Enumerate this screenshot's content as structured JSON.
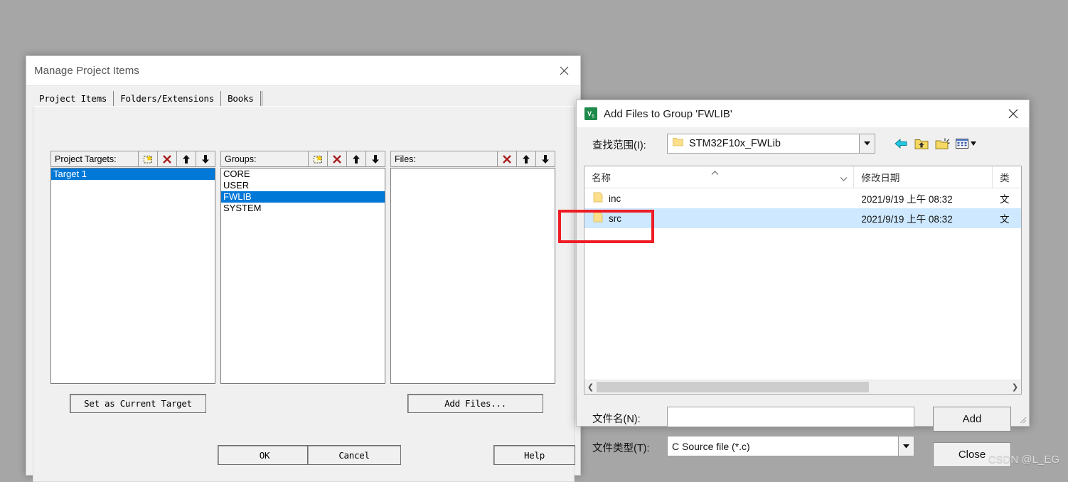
{
  "manage_dialog": {
    "title": "Manage Project Items",
    "close_icon": "close-icon",
    "tabs": [
      {
        "label": "Project Items",
        "active": true
      },
      {
        "label": "Folders/Extensions",
        "active": false
      },
      {
        "label": "Books",
        "active": false
      }
    ],
    "project_targets": {
      "header": "Project Targets:",
      "buttons": [
        "new-item-icon",
        "delete-icon",
        "move-up-icon",
        "move-down-icon"
      ],
      "items": [
        {
          "label": "Target 1",
          "selected": true
        }
      ]
    },
    "groups": {
      "header": "Groups:",
      "buttons": [
        "new-item-icon",
        "delete-icon",
        "move-up-icon",
        "move-down-icon"
      ],
      "items": [
        {
          "label": "CORE",
          "selected": false
        },
        {
          "label": "USER",
          "selected": false
        },
        {
          "label": "FWLIB",
          "selected": true
        },
        {
          "label": "SYSTEM",
          "selected": false
        }
      ]
    },
    "files": {
      "header": "Files:",
      "buttons": [
        "delete-icon",
        "move-up-icon",
        "move-down-icon"
      ],
      "items": []
    },
    "set_current_target_label": "Set as Current Target",
    "add_files_label": "Add Files...",
    "ok_label": "OK",
    "cancel_label": "Cancel",
    "help_label": "Help"
  },
  "add_files_dialog": {
    "title": "Add Files to Group 'FWLIB'",
    "app_icon": "keil-uvision-icon",
    "close_icon": "close-icon",
    "look_in_label": "查找范围(I):",
    "look_in_value": "STM32F10x_FWLib",
    "nav_icons": [
      "back-arrow-icon",
      "up-folder-icon",
      "new-folder-icon",
      "view-mode-icon"
    ],
    "columns": [
      {
        "label": "名称",
        "sorted": true,
        "sort_icon": "sort-ascending-icon"
      },
      {
        "label": "修改日期"
      },
      {
        "label": "类"
      }
    ],
    "rows": [
      {
        "name": "inc",
        "icon": "folder-icon",
        "modified": "2021/9/19 上午 08:32",
        "type": "文",
        "selected": false
      },
      {
        "name": "src",
        "icon": "folder-icon",
        "modified": "2021/9/19 上午 08:32",
        "type": "文",
        "selected": true
      }
    ],
    "scrollbar": {
      "left_icon": "chevron-left-icon",
      "right_icon": "chevron-right-icon",
      "thumb_percent": 66
    },
    "file_name_label": "文件名(N):",
    "file_name_value": "",
    "file_type_label": "文件类型(T):",
    "file_type_value": "C Source file (*.c)",
    "add_label": "Add",
    "close_label": "Close"
  },
  "annotation": {
    "highlight_target": "src-row-red-box",
    "color": "#ee1c25"
  },
  "watermark": "CSDN @L_EG",
  "colors": {
    "selection_blue": "#0078d7",
    "list_selection_light": "#cde8ff",
    "dialog_face": "#f0f0f0",
    "desktop": "#a6a6a6",
    "annotation_red": "#ee1c25"
  }
}
